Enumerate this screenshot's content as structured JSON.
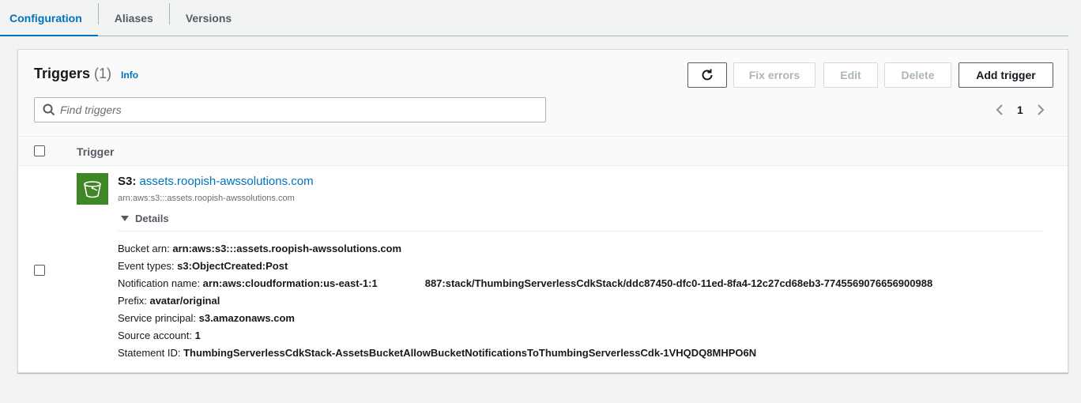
{
  "tabs": [
    {
      "label": "Configuration",
      "active": true
    },
    {
      "label": "Aliases",
      "active": false
    },
    {
      "label": "Versions",
      "active": false
    }
  ],
  "triggers": {
    "title": "Triggers",
    "count": "(1)",
    "info": "Info",
    "buttons": {
      "fix_errors": "Fix errors",
      "edit": "Edit",
      "delete": "Delete",
      "add_trigger": "Add trigger"
    },
    "search_placeholder": "Find triggers",
    "page_number": "1",
    "column_trigger": "Trigger",
    "row": {
      "prefix": "S3",
      "name": "assets.roopish-awssolutions.com",
      "arn": "arn:aws:s3:::assets.roopish-awssolutions.com",
      "details_label": "Details",
      "details": {
        "bucket_arn_label": "Bucket arn: ",
        "bucket_arn": "arn:aws:s3:::assets.roopish-awssolutions.com",
        "event_types_label": "Event types: ",
        "event_types": "s3:ObjectCreated:Post",
        "notification_name_label": "Notification name: ",
        "notification_name_start": "arn:aws:cloudformation:us-east-1:1",
        "notification_name_end": "887:stack/ThumbingServerlessCdkStack/ddc87450-dfc0-11ed-8fa4-12c27cd68eb3-7745569076656900988",
        "prefix_label": "Prefix: ",
        "prefix": "avatar/original",
        "service_principal_label": "Service principal: ",
        "service_principal": "s3.amazonaws.com",
        "source_account_label": "Source account: ",
        "source_account": "1",
        "statement_id_label": "Statement ID: ",
        "statement_id": "ThumbingServerlessCdkStack-AssetsBucketAllowBucketNotificationsToThumbingServerlessCdk-1VHQDQ8MHPO6N"
      }
    }
  },
  "colors": {
    "accent": "#0073bb",
    "s3_green": "#3f8624",
    "background": "#f2f3f3"
  }
}
